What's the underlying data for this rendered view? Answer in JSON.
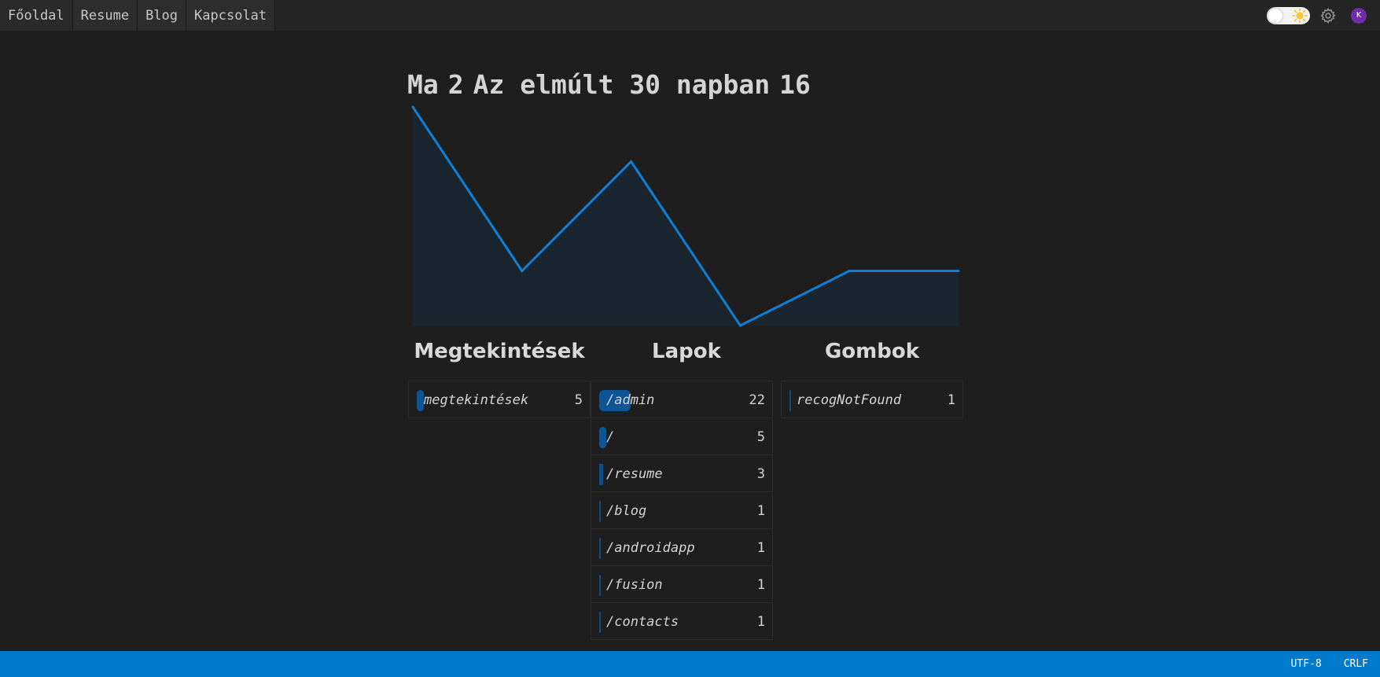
{
  "nav": {
    "items": [
      {
        "label": "Főoldal"
      },
      {
        "label": "Resume"
      },
      {
        "label": "Blog"
      },
      {
        "label": "Kapcsolat"
      }
    ]
  },
  "header_right": {
    "avatar_initial": "K",
    "theme_icon": "sun-icon",
    "settings_icon": "gear-icon"
  },
  "summary": {
    "today_label": "Ma",
    "today_value": "2",
    "month_label": "Az elmúlt 30 napban",
    "month_value": "16"
  },
  "chart_data": {
    "type": "area",
    "title": "",
    "xlabel": "",
    "ylabel": "",
    "values": [
      4,
      1,
      3,
      0,
      1,
      1
    ],
    "ylim": [
      0,
      4
    ],
    "line_color": "#0e7fd4",
    "fill_color": "#1b2530"
  },
  "columns": [
    {
      "title": "Megtekintések",
      "rows": [
        {
          "label": "megtekintések",
          "count": "5",
          "share": 0.227
        }
      ]
    },
    {
      "title": "Lapok",
      "rows": [
        {
          "label": "/admin",
          "count": "22",
          "share": 1.0
        },
        {
          "label": "/",
          "count": "5",
          "share": 0.227
        },
        {
          "label": "/resume",
          "count": "3",
          "share": 0.136
        },
        {
          "label": "/blog",
          "count": "1",
          "share": 0.045
        },
        {
          "label": "/androidapp",
          "count": "1",
          "share": 0.045
        },
        {
          "label": "/fusion",
          "count": "1",
          "share": 0.045
        },
        {
          "label": "/contacts",
          "count": "1",
          "share": 0.045
        }
      ]
    },
    {
      "title": "Gombok",
      "rows": [
        {
          "label": "recogNotFound",
          "count": "1",
          "share": 0.045
        }
      ]
    }
  ],
  "statusbar": {
    "encoding": "UTF-8",
    "line_ending": "CRLF"
  },
  "colors": {
    "accent": "#007acc",
    "bar": "#0f5596",
    "avatar": "#6f2da8"
  }
}
